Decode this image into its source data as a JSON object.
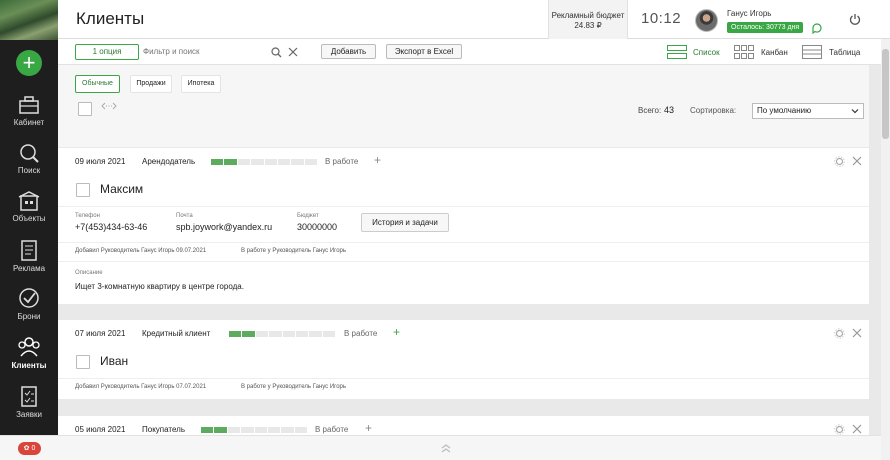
{
  "sidebar": {
    "items": [
      {
        "label": "Кабинет",
        "icon": "cabinet-icon"
      },
      {
        "label": "Поиск",
        "icon": "search-map-icon"
      },
      {
        "label": "Объекты",
        "icon": "objects-icon"
      },
      {
        "label": "Реклама",
        "icon": "ads-icon"
      },
      {
        "label": "Брони",
        "icon": "booking-icon"
      },
      {
        "label": "Клиенты",
        "icon": "clients-icon"
      },
      {
        "label": "Заявки",
        "icon": "requests-icon"
      }
    ]
  },
  "header": {
    "title": "Клиенты",
    "budget_label": "Рекламный бюджет",
    "budget_value": "24.83 ₽",
    "clock": "10:12",
    "user_name": "Ганус Игорь",
    "days_left": "Осталось: 30773 дня"
  },
  "toolbar": {
    "option_label": "1 опция",
    "search_placeholder": "Фильтр и поиск",
    "add_label": "Добавить",
    "export_label": "Экспорт в Excel",
    "views": [
      "Список",
      "Канбан",
      "Таблица"
    ]
  },
  "filters": {
    "tabs": [
      "Обычные",
      "Продажи",
      "Ипотека"
    ],
    "total_label": "Всего:",
    "total_value": "43",
    "sort_label": "Сортировка:",
    "sort_value": "По умолчанию"
  },
  "colors": {
    "accent": "#3aa745",
    "sidebar": "#1e1e1e",
    "progress": "#5dab5e"
  },
  "cards": [
    {
      "date": "09 июля 2021",
      "type": "Арендодатель",
      "progress": 0.25,
      "status": "В работе",
      "name": "Максим",
      "phone_label": "Телефон",
      "phone": "+7(453)434-63-46",
      "email_label": "Почта",
      "email": "spb.joywork@yandex.ru",
      "budget_label": "Бюджет",
      "budget": "30000000",
      "history_label": "История и задачи",
      "added": "Добавил Руководитель Ганус Игорь 09.07.2021",
      "in_work": "В работе у Руководитель Ганус Игорь",
      "desc_label": "Описание",
      "desc": "Ищет 3-комнатную квартиру в центре города."
    },
    {
      "date": "07 июля 2021",
      "type": "Кредитный клиент",
      "progress": 0.25,
      "status": "В работе",
      "name": "Иван",
      "added": "Добавил Руководитель Ганус Игорь 07.07.2021",
      "in_work": "В работе у Руководитель Ганус Игорь"
    },
    {
      "date": "05 июля 2021",
      "type": "Покупатель",
      "progress": 0.25,
      "status": "В работе"
    }
  ],
  "notifications": {
    "badge": "0"
  }
}
